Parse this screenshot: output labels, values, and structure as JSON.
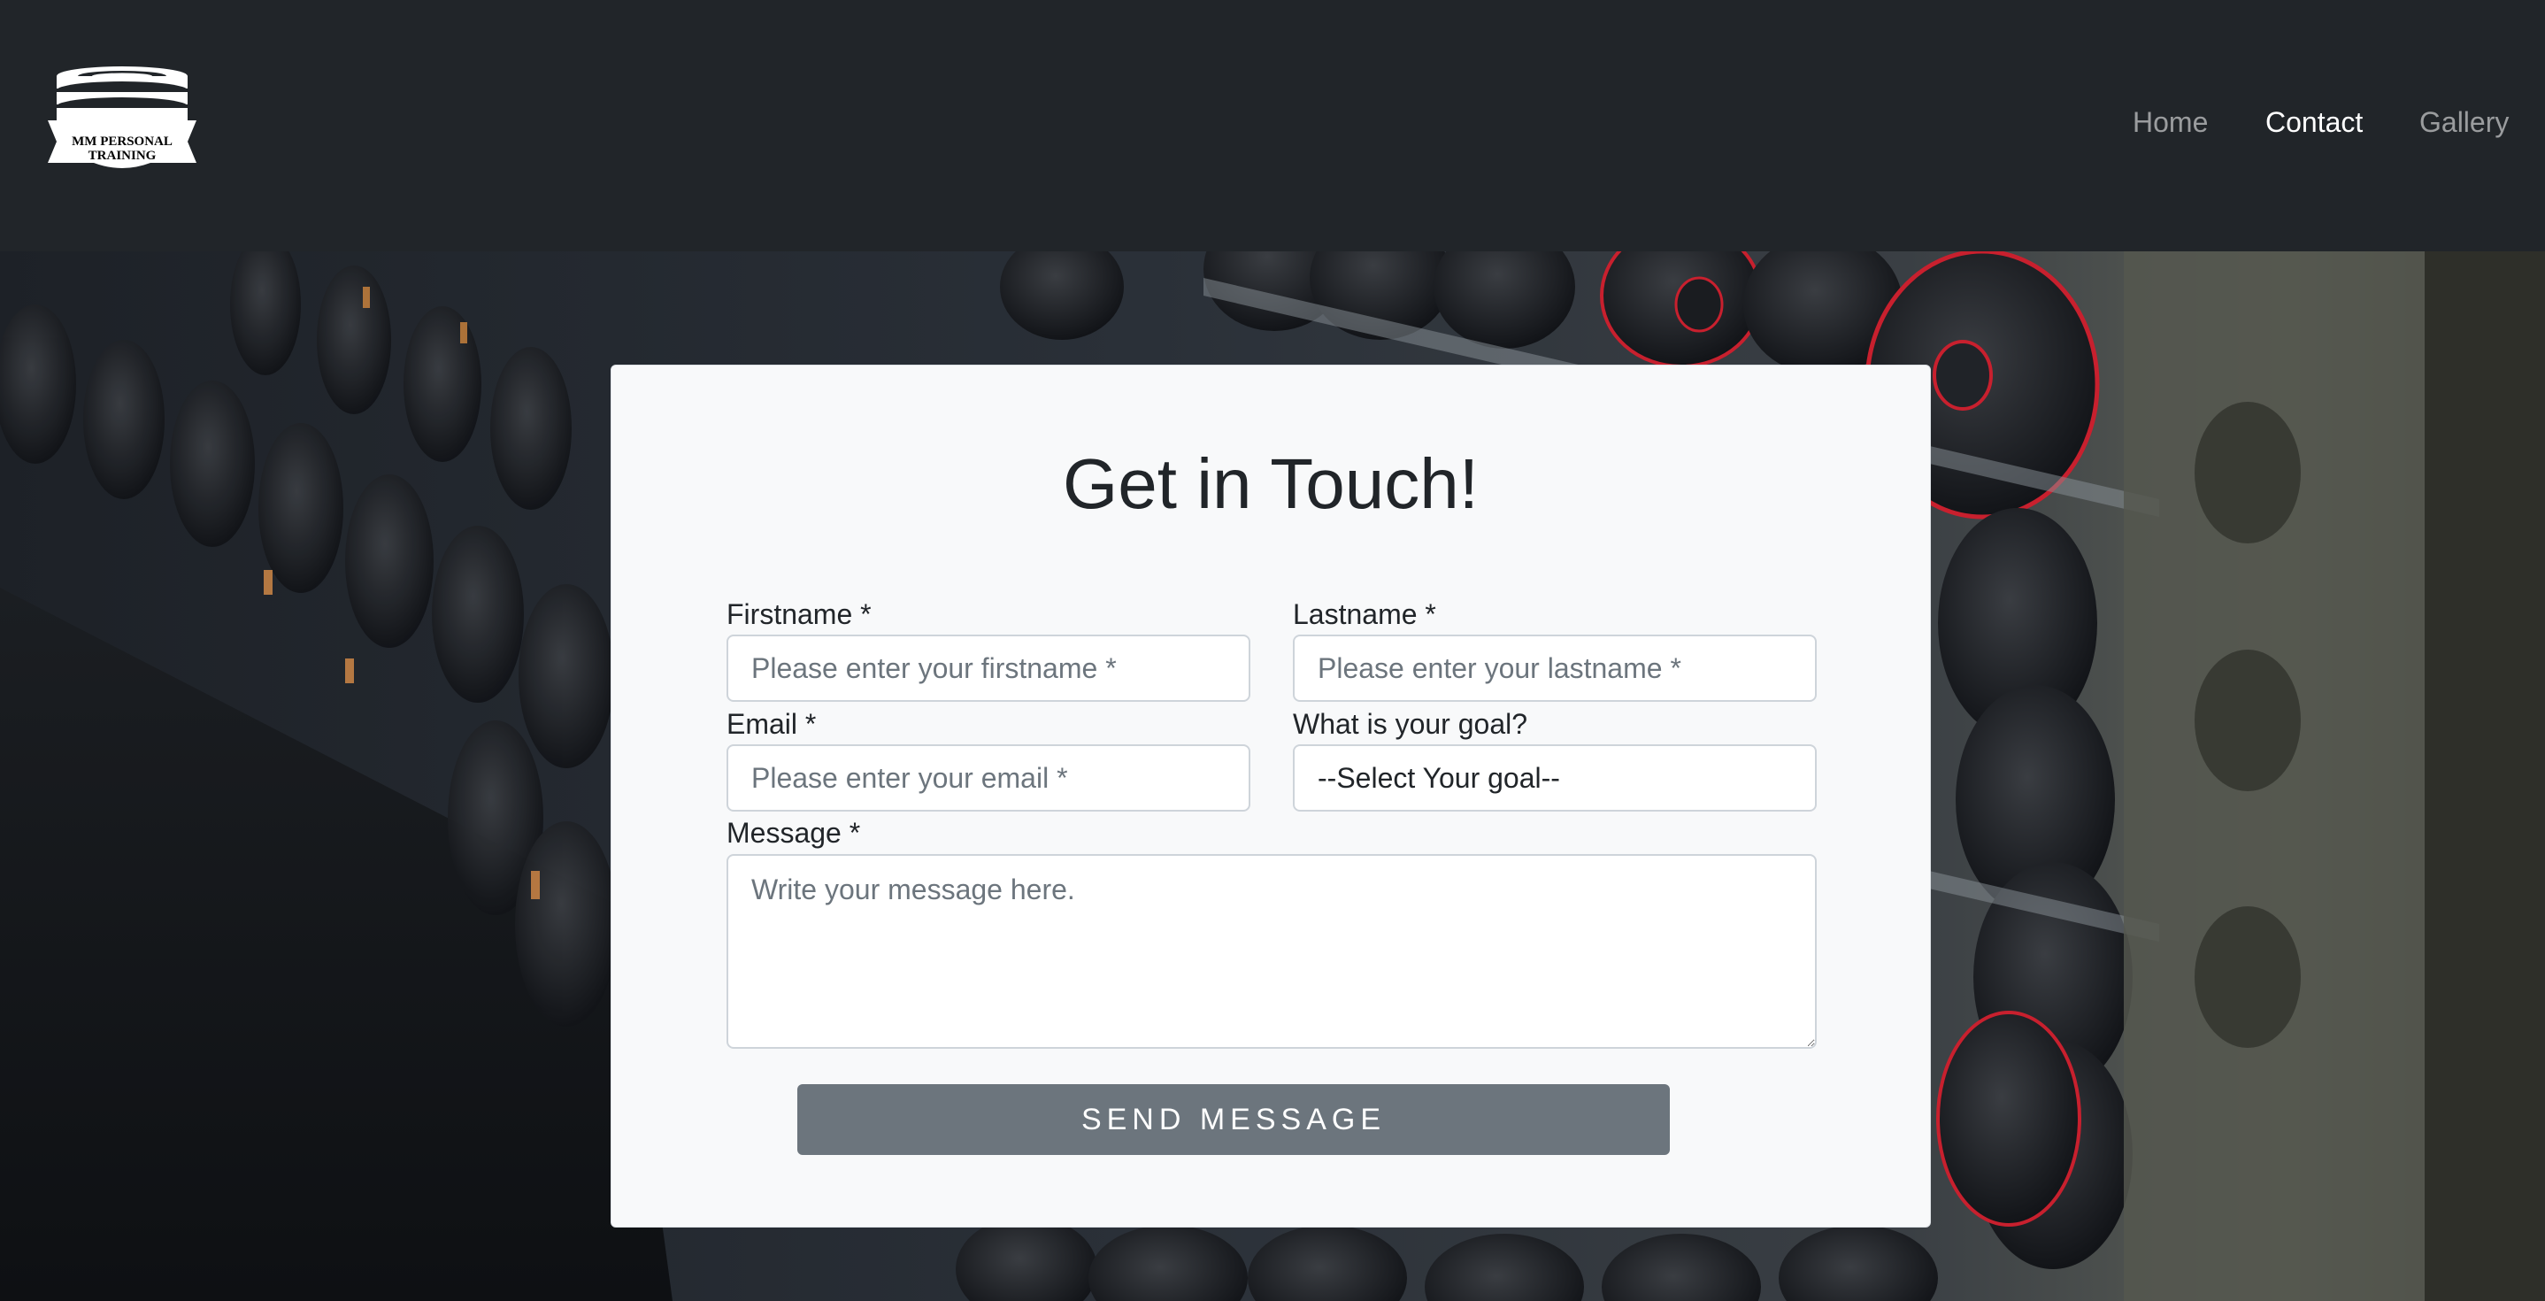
{
  "brand": {
    "logo_text_line1": "MM PERSONAL",
    "logo_text_line2": "TRAINING"
  },
  "nav": {
    "items": [
      {
        "label": "Home",
        "active": false
      },
      {
        "label": "Contact",
        "active": true
      },
      {
        "label": "Gallery",
        "active": false
      }
    ]
  },
  "form": {
    "title": "Get in Touch!",
    "firstname": {
      "label": "Firstname *",
      "placeholder": "Please enter your firstname *",
      "value": ""
    },
    "lastname": {
      "label": "Lastname *",
      "placeholder": "Please enter your lastname *",
      "value": ""
    },
    "email": {
      "label": "Email *",
      "placeholder": "Please enter your email *",
      "value": ""
    },
    "goal": {
      "label": "What is your goal?",
      "selected": "--Select Your goal--"
    },
    "message": {
      "label": "Message *",
      "placeholder": "Write your message here.",
      "value": ""
    },
    "submit_label": "SEND MESSAGE"
  },
  "colors": {
    "navbar_bg": "#212529",
    "card_bg": "#f8f9fa",
    "button_bg": "#6c757d",
    "plate_accent": "#c8202e"
  }
}
